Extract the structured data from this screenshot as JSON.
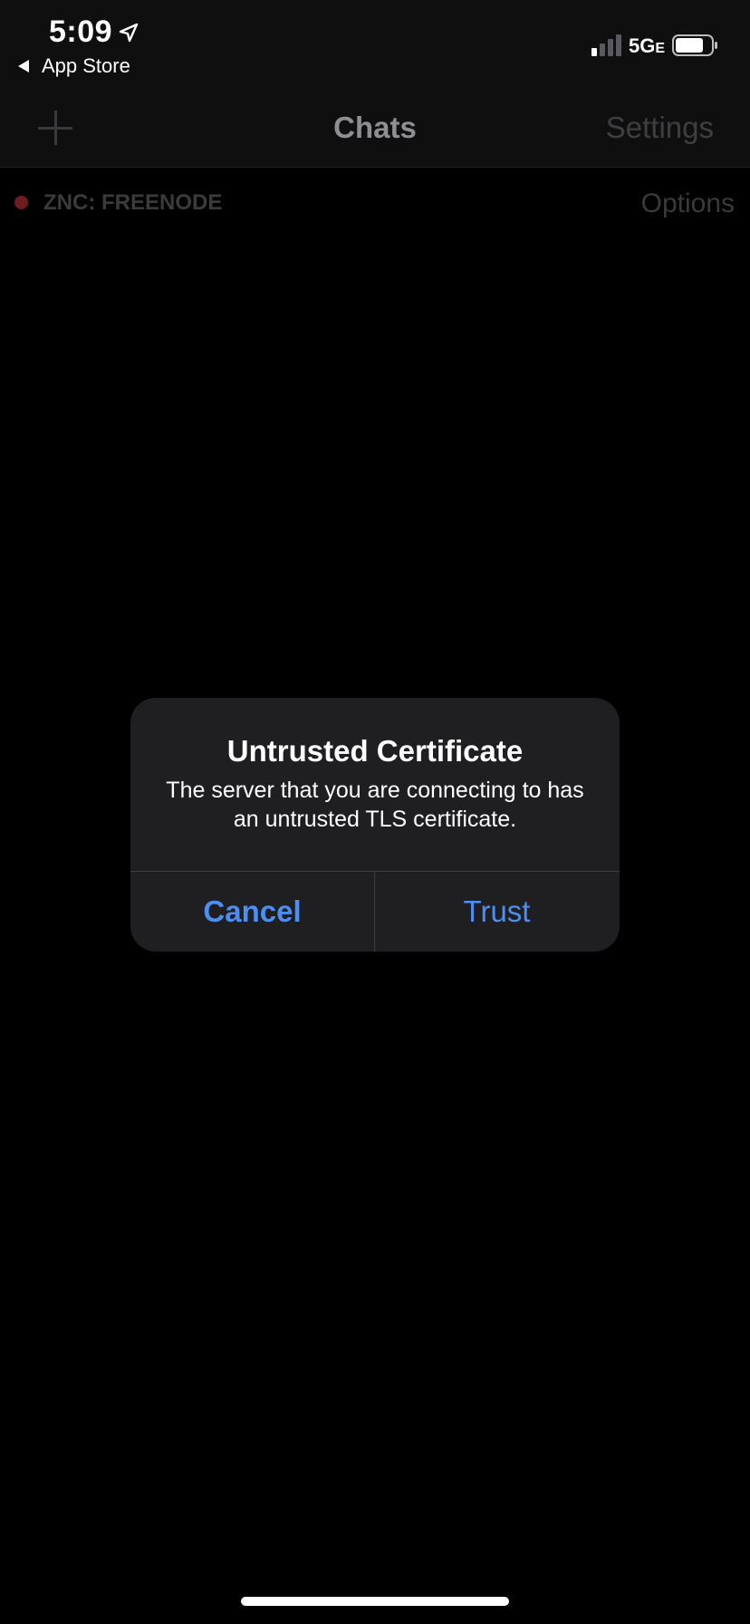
{
  "status_bar": {
    "time": "5:09",
    "back_app_label": "App Store",
    "network_type": "5G",
    "network_suffix": "E",
    "icons": [
      "location-arrow-icon",
      "cellular-signal-icon",
      "battery-icon"
    ]
  },
  "nav": {
    "title": "Chats",
    "add_icon": "plus-icon",
    "settings_label": "Settings"
  },
  "network": {
    "name": "ZNC: FREENODE",
    "status_color": "#6e1c1e",
    "options_label": "Options"
  },
  "alert": {
    "title": "Untrusted Certificate",
    "message": "The server that you are connecting to has an untrusted TLS certificate.",
    "cancel_label": "Cancel",
    "trust_label": "Trust",
    "accent_color": "#4d8ef0"
  }
}
